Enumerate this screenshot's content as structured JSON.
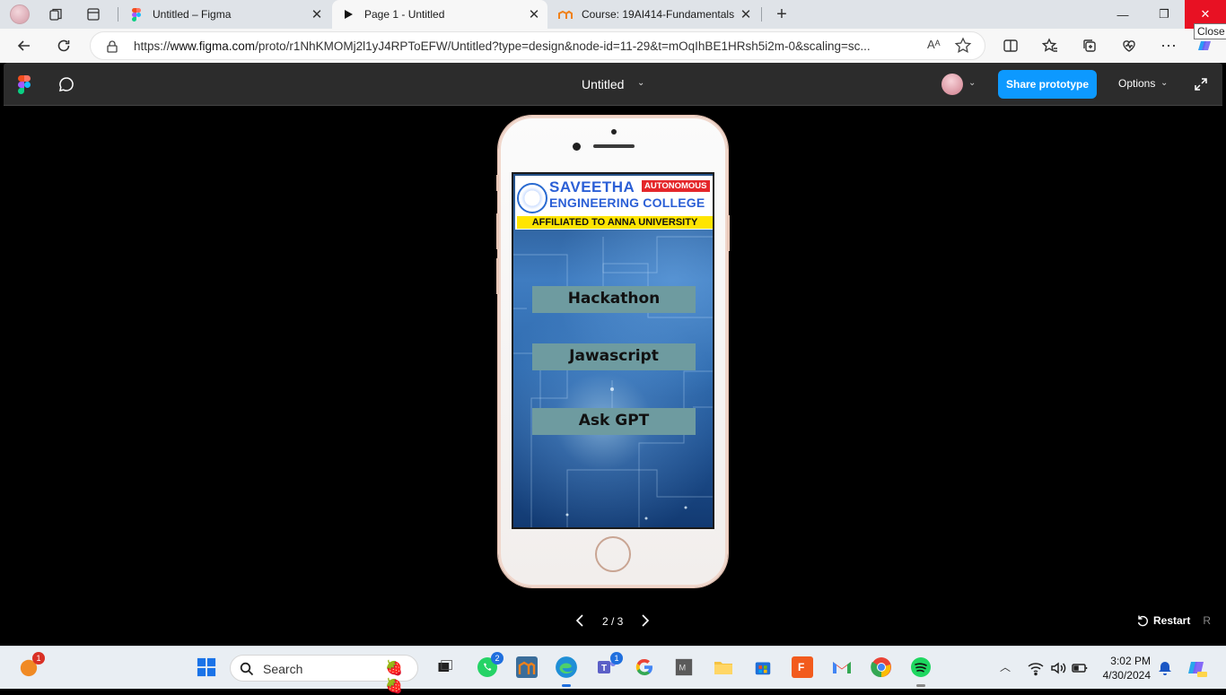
{
  "browser": {
    "tabs": [
      {
        "title": "Untitled – Figma",
        "favicon": "figma-icon",
        "active": false
      },
      {
        "title": "Page 1 - Untitled",
        "favicon": "play-icon",
        "active": true
      },
      {
        "title": "Course: 19AI414-Fundamentals c",
        "favicon": "moodle-icon",
        "active": false
      }
    ],
    "close_tooltip": "Close",
    "url_prefix": "https://",
    "url_domain": "www.figma.com",
    "url_rest": "/proto/r1NhKMOMj2l1yJ4RPToEFW/Untitled?type=design&node-id=11-29&t=mOqIhBE1HRsh5i2m-0&scaling=sc...",
    "read_aloud": "Aᴬ"
  },
  "figma": {
    "file_title": "Untitled",
    "share_label": "Share prototype",
    "options_label": "Options",
    "pager": "2 / 3",
    "restart_label": "Restart",
    "restart_key": "R",
    "accent": "#0d99ff"
  },
  "prototype": {
    "college_line1": "SAVEETHA",
    "autonomous": "AUTONOMOUS",
    "college_line2": "ENGINEERING COLLEGE",
    "affiliated": "AFFILIATED TO ANNA UNIVERSITY",
    "buttons": [
      "Hackathon",
      "Jawascript",
      "Ask GPT"
    ],
    "button_color": "#6e9ba0"
  },
  "taskbar": {
    "search_label": "Search",
    "whatsapp_badge": "2",
    "teams_badge": "1",
    "notif_badge": "1",
    "time": "3:02 PM",
    "date": "4/30/2024"
  }
}
